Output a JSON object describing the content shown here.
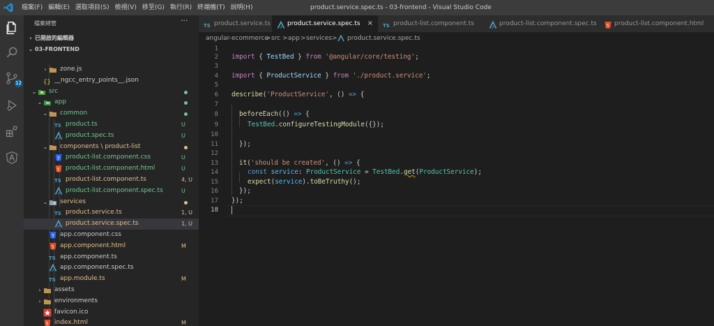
{
  "window": {
    "title": "product.service.spec.ts - 03-frontend - Visual Studio Code",
    "menu": [
      "檔案(F)",
      "編輯(E)",
      "選取項目(S)",
      "檢視(V)",
      "移至(G)",
      "執行(R)",
      "終端機(T)",
      "說明(H)"
    ]
  },
  "activity": {
    "scm_badge": "12"
  },
  "sidebar": {
    "header": "檔案總管",
    "more": "···",
    "open_editors": "已開啟的編輯器",
    "project": "03-FRONTEND",
    "tree": [
      {
        "label": "zone.js",
        "icon": "folder-icon",
        "color": "#cccccc",
        "status": ""
      },
      {
        "label": "__ngcc_entry_points__.json",
        "icon": "json-icon",
        "color": "#cccccc",
        "status": ""
      },
      {
        "label": "src",
        "icon": "folder-src-icon",
        "color": "#73c991",
        "status": "dot"
      },
      {
        "label": "app",
        "icon": "folder-app-icon",
        "color": "#73c991",
        "status": "dot"
      },
      {
        "label": "common",
        "icon": "folder-icon",
        "color": "#73c991",
        "status": "dot"
      },
      {
        "label": "product.ts",
        "icon": "ts-icon",
        "color": "#73c991",
        "status": "U"
      },
      {
        "label": "product.spec.ts",
        "icon": "angular-spec-icon",
        "color": "#73c991",
        "status": "U"
      },
      {
        "label": "components \\ product-list",
        "icon": "folder-icon",
        "color": "#e2c08d",
        "status": "dot"
      },
      {
        "label": "product-list.component.css",
        "icon": "css-icon",
        "color": "#73c991",
        "status": "U"
      },
      {
        "label": "product-list.component.html",
        "icon": "html-icon",
        "color": "#73c991",
        "status": "U"
      },
      {
        "label": "product-list.component.ts",
        "icon": "ts-icon",
        "color": "#e2c08d",
        "status": "4, U"
      },
      {
        "label": "product-list.component.spec.ts",
        "icon": "angular-spec-icon",
        "color": "#73c991",
        "status": "U"
      },
      {
        "label": "services",
        "icon": "folder-services-icon",
        "color": "#e2c08d",
        "status": "dot"
      },
      {
        "label": "product.service.ts",
        "icon": "ts-icon",
        "color": "#e2c08d",
        "status": "1, U"
      },
      {
        "label": "product.service.spec.ts",
        "icon": "angular-spec-icon",
        "color": "#e2c08d",
        "status": "1, U"
      },
      {
        "label": "app.component.css",
        "icon": "css-icon",
        "color": "#cccccc",
        "status": ""
      },
      {
        "label": "app.component.html",
        "icon": "html-icon",
        "color": "#e2c08d",
        "status": "M"
      },
      {
        "label": "app.component.ts",
        "icon": "ts-icon",
        "color": "#cccccc",
        "status": ""
      },
      {
        "label": "app.component.spec.ts",
        "icon": "angular-spec-icon",
        "color": "#cccccc",
        "status": ""
      },
      {
        "label": "app.module.ts",
        "icon": "ts-icon",
        "color": "#e2c08d",
        "status": "M"
      },
      {
        "label": "assets",
        "icon": "folder-icon",
        "color": "#cccccc",
        "status": ""
      },
      {
        "label": "environments",
        "icon": "folder-icon",
        "color": "#cccccc",
        "status": ""
      },
      {
        "label": "favicon.ico",
        "icon": "favicon-icon",
        "color": "#cccccc",
        "status": ""
      },
      {
        "label": "index.html",
        "icon": "html-icon",
        "color": "#e2c08d",
        "status": "M"
      }
    ]
  },
  "tabs": [
    {
      "label": "product.service.ts",
      "icon": "ts-icon",
      "active": false
    },
    {
      "label": "product.service.spec.ts",
      "icon": "angular-spec-icon",
      "active": true,
      "close": "×"
    },
    {
      "label": "product-list.component.ts",
      "icon": "ts-icon",
      "active": false
    },
    {
      "label": "product-list.component.spec.ts",
      "icon": "angular-spec-icon",
      "active": false
    },
    {
      "label": "product-list.component.html",
      "icon": "html-icon",
      "active": false
    }
  ],
  "breadcrumb": [
    "angular-ecommerce",
    "src",
    "app",
    "services",
    "product.service.spec.ts"
  ],
  "breadcrumb_sep": ">",
  "editor": {
    "line_numbers": [
      "1",
      "2",
      "3",
      "4",
      "5",
      "6",
      "7",
      "8",
      "9",
      "10",
      "11",
      "12",
      "13",
      "14",
      "15",
      "16",
      "17",
      "18"
    ],
    "code": {
      "l2_kw": "import",
      "l2_a": " { ",
      "l2_id": "TestBed",
      "l2_b": " } ",
      "l2_from": "from",
      "l2_sp": " ",
      "l2_str": "'@angular/core/testing'",
      "l2_end": ";",
      "l4_kw": "import",
      "l4_a": " { ",
      "l4_id": "ProductService",
      "l4_b": " } ",
      "l4_from": "from",
      "l4_sp": " ",
      "l4_str": "'./product.service'",
      "l4_end": ";",
      "l6_fn": "describe",
      "l6_a": "(",
      "l6_str": "'ProductService'",
      "l6_b": ", () ",
      "l6_arrow": "=>",
      "l6_c": " {",
      "l8_fn": "beforeEach",
      "l8_a": "(() ",
      "l8_arrow": "=>",
      "l8_b": " {",
      "l9_id": "TestBed",
      "l9_a": ".",
      "l9_fn": "configureTestingModule",
      "l9_b": "({});",
      "l11": "});",
      "l13_fn": "it",
      "l13_a": "(",
      "l13_str": "'should be created'",
      "l13_b": ", () ",
      "l13_arrow": "=>",
      "l13_c": " {",
      "l14_kw": "const",
      "l14_sp": " ",
      "l14_var": "service",
      "l14_a": ": ",
      "l14_ty": "ProductService",
      "l14_b": " = ",
      "l14_id": "TestBed",
      "l14_c": ".",
      "l14_fn": "get",
      "l14_d": "(",
      "l14_ty2": "ProductService",
      "l14_e": ");",
      "l15_fn": "expect",
      "l15_a": "(",
      "l15_var": "service",
      "l15_b": ").",
      "l15_fn2": "toBeTruthy",
      "l15_c": "();",
      "l16": "});",
      "l17": "});"
    }
  },
  "colors": {
    "added": "#73c991",
    "modified": "#e2c08d",
    "accent": "#0e639c"
  }
}
